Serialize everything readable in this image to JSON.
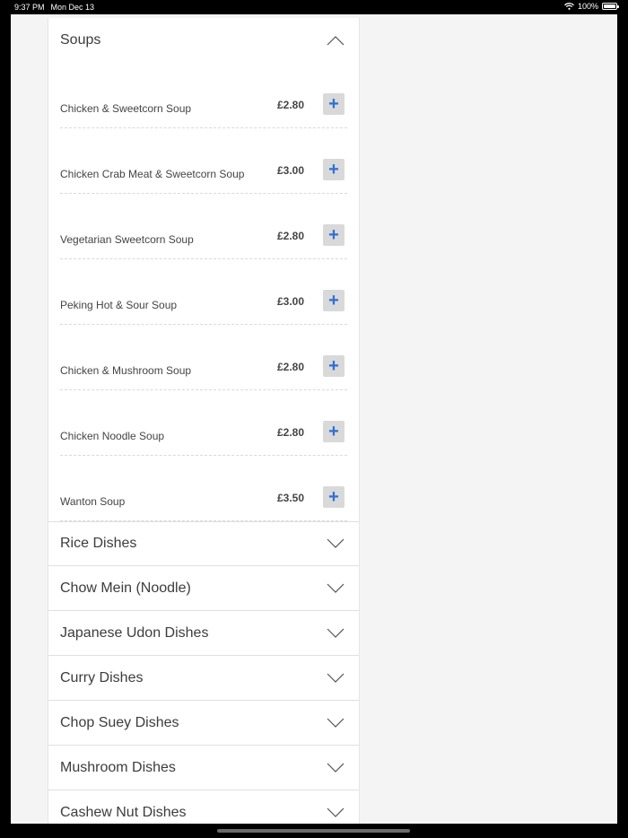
{
  "status_bar": {
    "time": "9:37 PM",
    "date": "Mon Dec 13",
    "battery": "100%",
    "wifi_icon": "wifi-icon",
    "battery_icon": "battery-icon"
  },
  "menu": {
    "open_section": {
      "title": "Soups",
      "items": [
        {
          "name": "Chicken & Sweetcorn Soup",
          "price": "£2.80",
          "add": "+"
        },
        {
          "name": "Chicken Crab Meat & Sweetcorn Soup",
          "price": "£3.00",
          "add": "+"
        },
        {
          "name": "Vegetarian Sweetcorn Soup",
          "price": "£2.80",
          "add": "+"
        },
        {
          "name": "Peking Hot & Sour Soup",
          "price": "£3.00",
          "add": "+"
        },
        {
          "name": "Chicken & Mushroom Soup",
          "price": "£2.80",
          "add": "+"
        },
        {
          "name": "Chicken Noodle Soup",
          "price": "£2.80",
          "add": "+"
        },
        {
          "name": "Wanton Soup",
          "price": "£3.50",
          "add": "+"
        }
      ]
    },
    "collapsed_sections": [
      "Rice Dishes",
      "Chow Mein (Noodle)",
      "Japanese Udon Dishes",
      "Curry Dishes",
      "Chop Suey Dishes",
      "Mushroom Dishes",
      "Cashew Nut Dishes"
    ]
  },
  "colors": {
    "accent": "#2e6fd6",
    "background": "#f4f4f4",
    "panel": "#ffffff"
  }
}
